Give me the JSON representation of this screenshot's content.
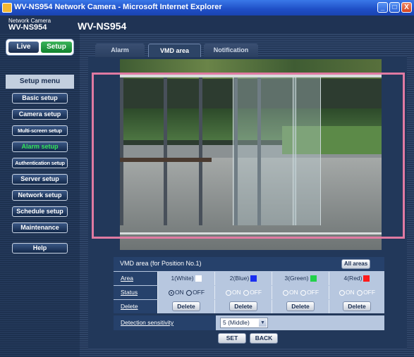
{
  "window": {
    "title": "WV-NS954 Network Camera - Microsoft Internet Explorer",
    "minimize_label": "_",
    "maximize_label": "□",
    "close_label": "X"
  },
  "brand": {
    "small_label": "Network Camera",
    "model": "WV-NS954",
    "page_model": "WV-NS954"
  },
  "mode": {
    "live_label": "Live",
    "setup_label": "Setup"
  },
  "sidebar": {
    "menu_title": "Setup menu",
    "items": [
      {
        "label": "Basic setup",
        "active": false
      },
      {
        "label": "Camera setup",
        "active": false
      },
      {
        "label": "Multi-screen setup",
        "active": false
      },
      {
        "label": "Alarm setup",
        "active": true
      },
      {
        "label": "Authentication setup",
        "active": false
      },
      {
        "label": "Server setup",
        "active": false
      },
      {
        "label": "Network setup",
        "active": false
      },
      {
        "label": "Schedule setup",
        "active": false
      },
      {
        "label": "Maintenance",
        "active": false
      }
    ],
    "help_label": "Help"
  },
  "tabs": [
    {
      "label": "Alarm",
      "active": false
    },
    {
      "label": "VMD area",
      "active": true
    },
    {
      "label": "Notification",
      "active": false
    }
  ],
  "vmd": {
    "heading": "VMD area (for Position No.1)",
    "all_areas_label": "All areas",
    "area_row_label": "Area",
    "status_row_label": "Status",
    "delete_row_label": "Delete",
    "areas": [
      {
        "label": "1(White)",
        "color": "#ffffff",
        "status_on": "ON",
        "status_off": "OFF",
        "status_enabled": true,
        "delete_label": "Delete"
      },
      {
        "label": "2(Blue)",
        "color": "#1a2ef0",
        "status_on": "ON",
        "status_off": "OFF",
        "status_enabled": false,
        "delete_label": "Delete"
      },
      {
        "label": "3(Green)",
        "color": "#21d24a",
        "status_on": "ON",
        "status_off": "OFF",
        "status_enabled": false,
        "delete_label": "Delete"
      },
      {
        "label": "4(Red)",
        "color": "#ff1a1a",
        "status_on": "ON",
        "status_off": "OFF",
        "status_enabled": false,
        "delete_label": "Delete"
      }
    ],
    "area_outline_color": "#e07aa2",
    "sensitivity_label": "Detection sensitivity",
    "sensitivity_value": "5 (Middle)"
  },
  "actions": {
    "set_label": "SET",
    "back_label": "BACK"
  }
}
